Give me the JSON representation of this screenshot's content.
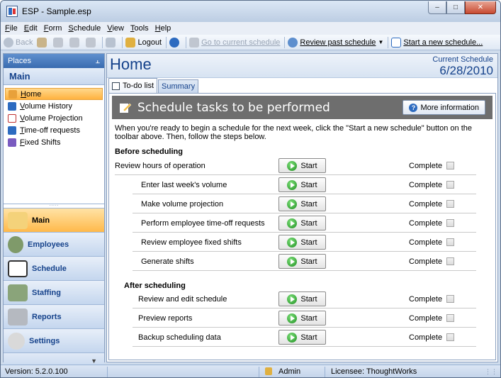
{
  "window": {
    "title": "ESP - Sample.esp"
  },
  "menu": [
    "File",
    "Edit",
    "Form",
    "Schedule",
    "View",
    "Tools",
    "Help"
  ],
  "toolbar": {
    "back": "Back",
    "logout": "Logout",
    "go_current": "Go to current schedule",
    "review_past": "Review past schedule",
    "start_new": "Start a new schedule..."
  },
  "places": {
    "header": "Places",
    "pin": " Ͱ",
    "section": "Main",
    "items": [
      {
        "label": "Home",
        "color": "#e8a13a"
      },
      {
        "label": "Volume History",
        "color": "#2d6bc0"
      },
      {
        "label": "Volume Projection",
        "color": "#c03030"
      },
      {
        "label": "Time-off requests",
        "color": "#2d6bc0"
      },
      {
        "label": "Fixed Shifts",
        "color": "#7a5bc0"
      }
    ],
    "groups": [
      "Main",
      "Employees",
      "Schedule",
      "Staffing",
      "Reports",
      "Settings"
    ]
  },
  "page": {
    "title": "Home",
    "current_schedule_label": "Current Schedule",
    "current_schedule_date": "6/28/2010"
  },
  "tabs": [
    "To-do list",
    "Summary"
  ],
  "todo": {
    "banner_title": "Schedule tasks to be performed",
    "more_info": "More information",
    "intro": "When you're ready to begin a schedule for the next week, click the \"Start a new schedule\" button on the toolbar above. Then, follow the steps below.",
    "before_heading": "Before scheduling",
    "after_heading": "After scheduling",
    "start_label": "Start",
    "complete_label": "Complete",
    "before_tasks": [
      "Review hours of operation",
      "Enter last week's volume",
      "Make volume projection",
      "Perform employee time-off requests",
      "Review employee fixed shifts",
      "Generate shifts"
    ],
    "after_tasks": [
      "Review and edit schedule",
      "Preview reports",
      "Backup scheduling data"
    ]
  },
  "status": {
    "version": "Version: 5.2.0.100",
    "user": "Admin",
    "licensee": "Licensee: ThoughtWorks"
  }
}
